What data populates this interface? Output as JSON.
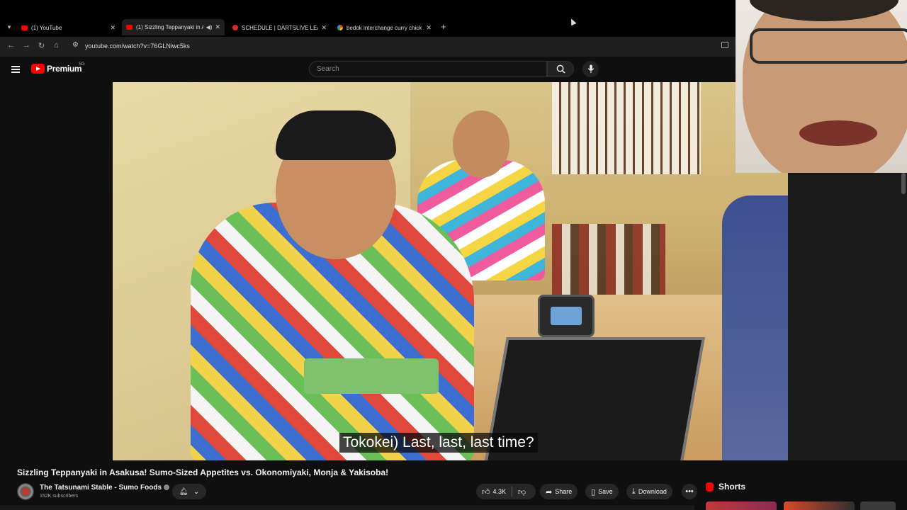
{
  "browser": {
    "tabs": [
      {
        "label": "(1) YouTube",
        "favicon": "youtube-icon"
      },
      {
        "label": "(1) Sizzling Teppanyaki in A",
        "favicon": "youtube-icon",
        "active": true,
        "audio": true
      },
      {
        "label": "SCHEDULE | DARTSLIVE LEAGUE",
        "favicon": "dartslive-icon"
      },
      {
        "label": "bedok interchange curry chick",
        "favicon": "google-icon"
      }
    ],
    "new_tab": "+",
    "url": "youtube.com/watch?v=76GLNiwc5ks"
  },
  "youtube": {
    "logo_text": "Premium",
    "region": "SG",
    "search_placeholder": "Search"
  },
  "video": {
    "subtitle": "Tokokei) Last, last, last time?"
  },
  "details": {
    "title": "Sizzling Teppanyaki in Asakusa! Sumo-Sized Appetites vs. Okonomiyaki, Monja & Yakisoba!",
    "channel": "The Tatsunami Stable - Sumo Foods",
    "subscribers": "152K subscribers",
    "likes": "4.3K",
    "share": "Share",
    "save": "Save",
    "download": "Download",
    "more": "•••"
  },
  "sidebar": {
    "shorts_label": "Shorts"
  },
  "colors": {
    "brand_red": "#ff0000",
    "background": "#0f0f0f"
  }
}
